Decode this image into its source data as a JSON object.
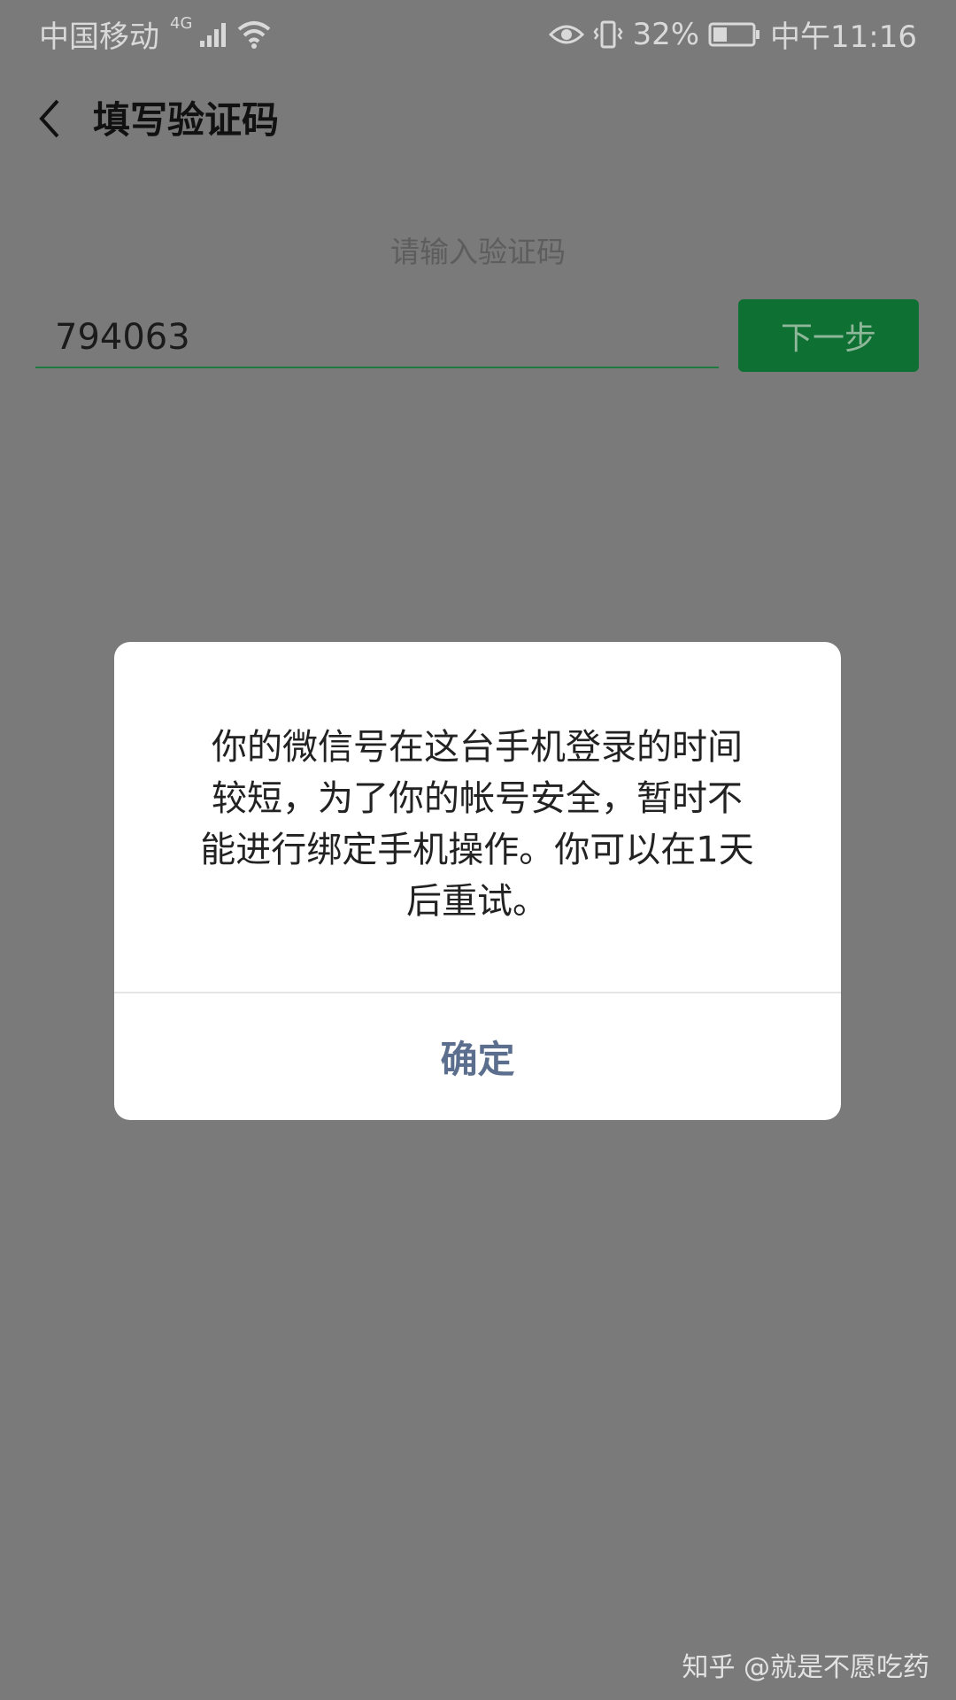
{
  "status_bar": {
    "carrier": "中国移动",
    "network": "4G",
    "battery_percent": "32%",
    "time": "中午11:16"
  },
  "app_bar": {
    "title": "填写验证码"
  },
  "verification": {
    "hint": "请输入验证码",
    "code_value": "794063",
    "next_label": "下一步"
  },
  "dialog": {
    "message": "你的微信号在这台手机登录的时间\n较短，为了你的帐号安全，暂时不\n能进行绑定手机操作。你可以在1天\n后重试。",
    "confirm_label": "确定"
  },
  "watermark": {
    "text": "知乎 @就是不愿吃药"
  },
  "colors": {
    "overlay": "#7a7a7a",
    "accent_green": "#0f7033",
    "confirm_text": "#5b6e8d"
  }
}
